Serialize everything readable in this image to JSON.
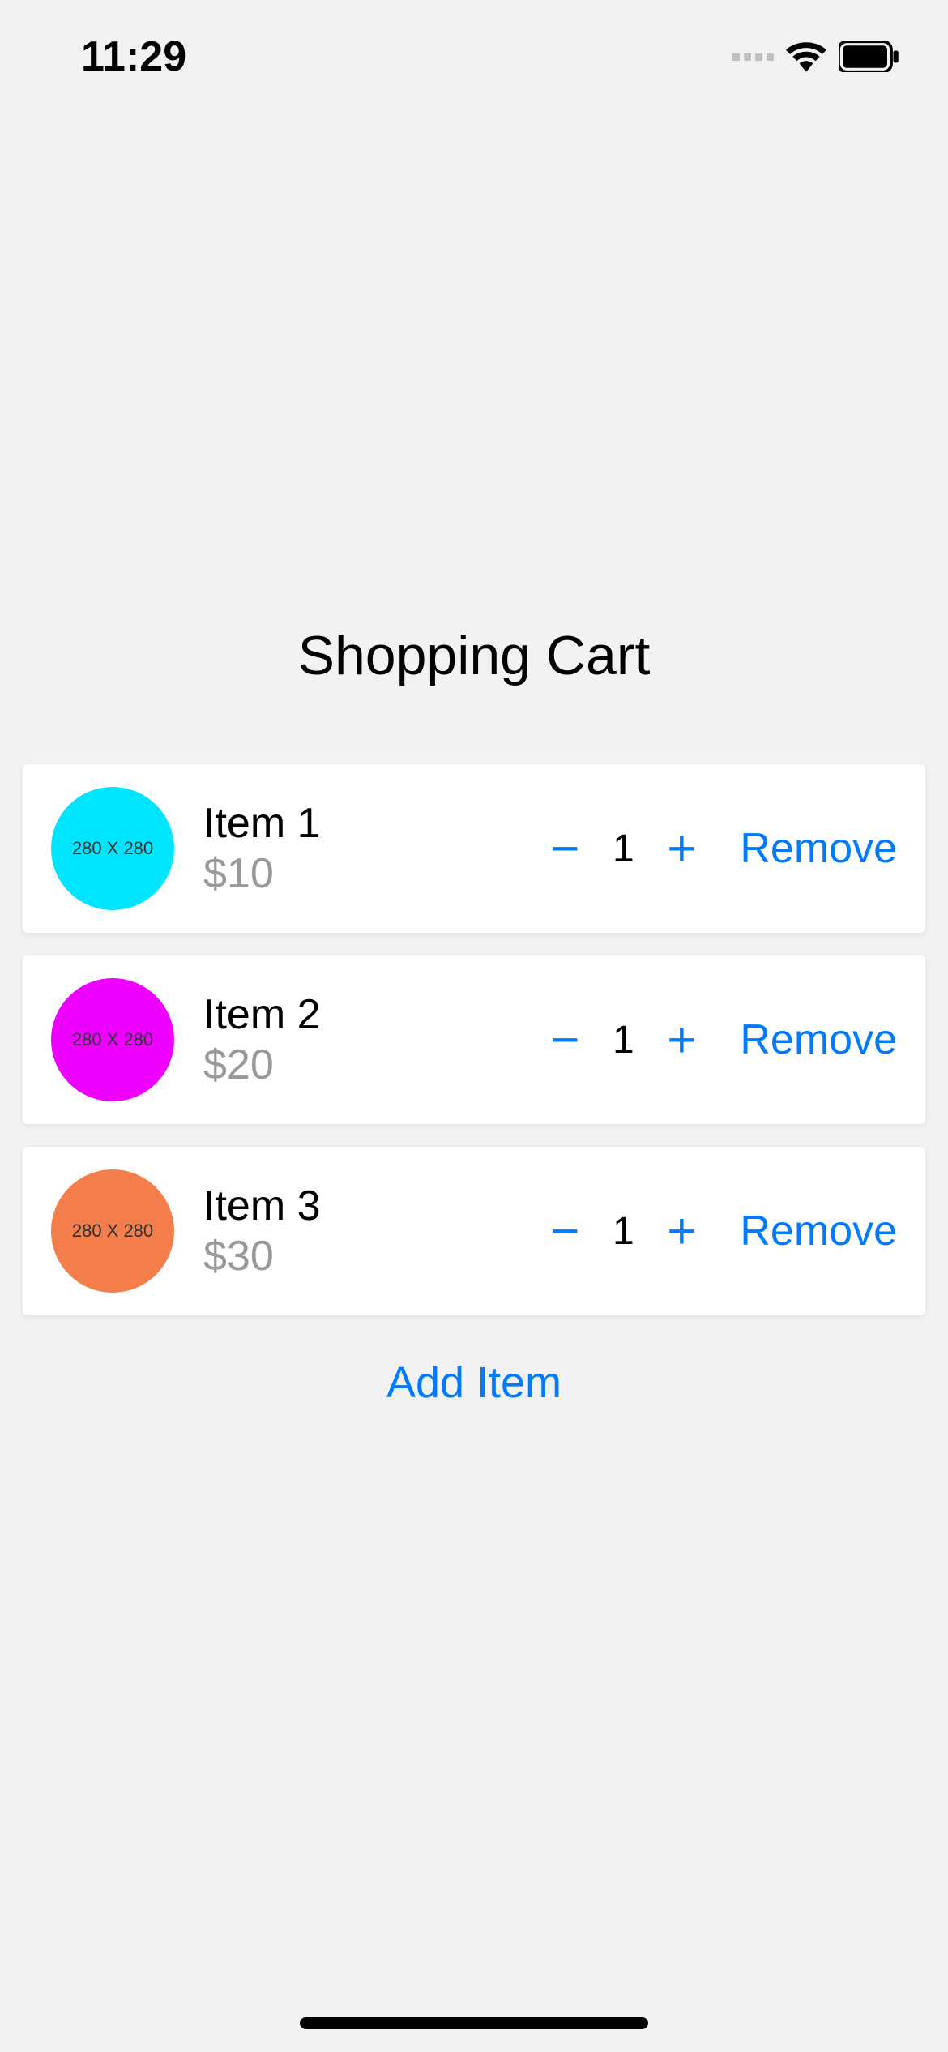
{
  "status": {
    "time": "11:29"
  },
  "page": {
    "title": "Shopping Cart"
  },
  "cart": {
    "items": [
      {
        "name": "Item 1",
        "price": "$10",
        "quantity": "1",
        "image_label": "280 X 280",
        "image_color": "#00e5ff"
      },
      {
        "name": "Item 2",
        "price": "$20",
        "quantity": "1",
        "image_label": "280 X 280",
        "image_color": "#ee00ff"
      },
      {
        "name": "Item 3",
        "price": "$30",
        "quantity": "1",
        "image_label": "280 X 280",
        "image_color": "#f37e4c"
      }
    ]
  },
  "labels": {
    "decrement": "−",
    "increment": "+",
    "remove": "Remove",
    "add_item": "Add Item"
  }
}
